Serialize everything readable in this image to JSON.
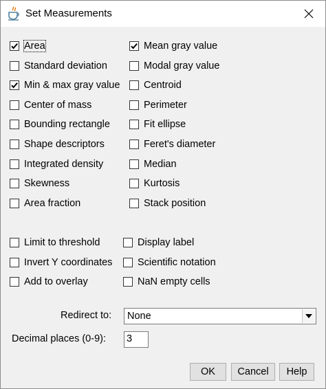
{
  "window": {
    "title": "Set Measurements"
  },
  "measurements": [
    {
      "label": "Area",
      "checked": true
    },
    {
      "label": "Mean gray value",
      "checked": true
    },
    {
      "label": "Standard deviation",
      "checked": false
    },
    {
      "label": "Modal gray value",
      "checked": false
    },
    {
      "label": "Min & max gray value",
      "checked": true
    },
    {
      "label": "Centroid",
      "checked": false
    },
    {
      "label": "Center of mass",
      "checked": false
    },
    {
      "label": "Perimeter",
      "checked": false
    },
    {
      "label": "Bounding rectangle",
      "checked": false
    },
    {
      "label": "Fit ellipse",
      "checked": false
    },
    {
      "label": "Shape descriptors",
      "checked": false
    },
    {
      "label": "Feret's diameter",
      "checked": false
    },
    {
      "label": "Integrated density",
      "checked": false
    },
    {
      "label": "Median",
      "checked": false
    },
    {
      "label": "Skewness",
      "checked": false
    },
    {
      "label": "Kurtosis",
      "checked": false
    },
    {
      "label": "Area fraction",
      "checked": false
    },
    {
      "label": "Stack position",
      "checked": false
    }
  ],
  "options": [
    {
      "label": "Limit to threshold",
      "checked": false
    },
    {
      "label": "Display label",
      "checked": false
    },
    {
      "label": "Invert Y coordinates",
      "checked": false
    },
    {
      "label": "Scientific notation",
      "checked": false
    },
    {
      "label": "Add to overlay",
      "checked": false
    },
    {
      "label": "NaN empty cells",
      "checked": false
    }
  ],
  "redirect": {
    "label": "Redirect to:",
    "value": "None"
  },
  "decimal": {
    "label": "Decimal places (0-9):",
    "value": "3"
  },
  "buttons": {
    "ok": "OK",
    "cancel": "Cancel",
    "help": "Help"
  }
}
